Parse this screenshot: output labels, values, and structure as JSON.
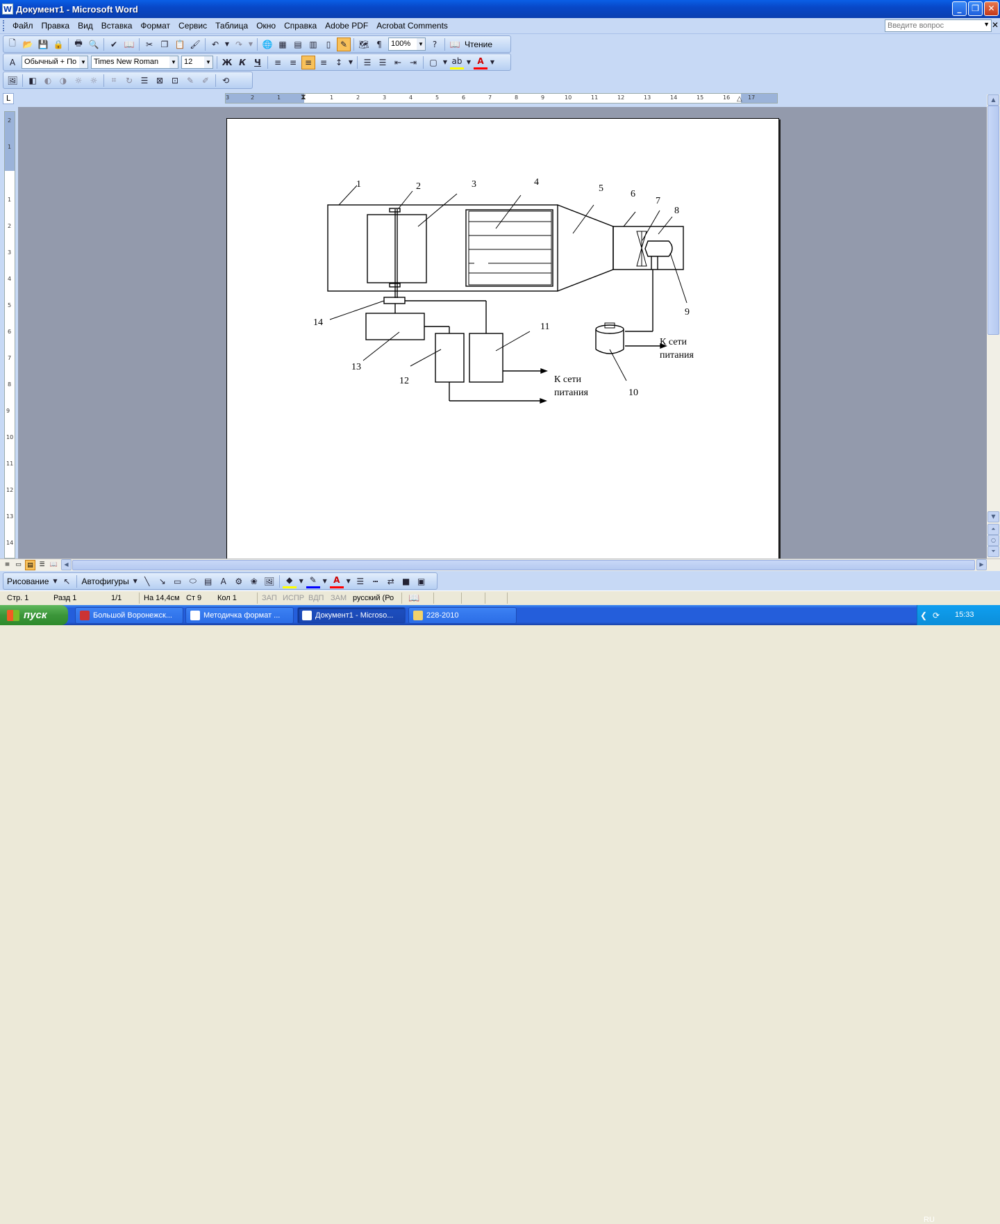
{
  "window": {
    "title": "Документ1 - Microsoft Word",
    "minimize": "_",
    "restore": "❐",
    "close": "✕"
  },
  "menu": {
    "items": [
      "Файл",
      "Правка",
      "Вид",
      "Вставка",
      "Формат",
      "Сервис",
      "Таблица",
      "Окно",
      "Справка",
      "Adobe PDF",
      "Acrobat Comments"
    ],
    "help_placeholder": "Введите вопрос"
  },
  "toolbar": {
    "zoom": "100%",
    "reading_label": "Чтение",
    "style": "Обычный + По г",
    "font": "Times New Roman",
    "size": "12",
    "bold": "Ж",
    "italic": "К",
    "underline": "Ч"
  },
  "ruler": {
    "h_labels": [
      "3",
      "2",
      "1",
      "1",
      "2",
      "3",
      "4",
      "5",
      "6",
      "7",
      "8",
      "9",
      "10",
      "11",
      "12",
      "13",
      "14",
      "15",
      "16",
      "17"
    ],
    "v_labels": [
      "2",
      "1",
      "1",
      "2",
      "3",
      "4",
      "5",
      "6",
      "7",
      "8",
      "9",
      "10",
      "11",
      "12",
      "13",
      "14"
    ]
  },
  "diagram": {
    "labels": [
      "1",
      "2",
      "3",
      "4",
      "5",
      "6",
      "7",
      "8",
      "9",
      "10",
      "11",
      "12",
      "13",
      "14"
    ],
    "power_label_1a": "К сети",
    "power_label_1b": "питания",
    "power_label_2a": "К сети",
    "power_label_2b": "питания"
  },
  "drawing_toolbar": {
    "draw": "Рисование",
    "autoshapes": "Автофигуры"
  },
  "status": {
    "page": "Стр. 1",
    "section": "Разд 1",
    "pages": "1/1",
    "at": "На 14,4см",
    "line": "Ст 9",
    "col": "Кол 1",
    "rec": "ЗАП",
    "trk": "ИСПР",
    "ext": "ВДП",
    "ovr": "ЗАМ",
    "lang": "русский (Ро"
  },
  "taskbar": {
    "start": "пуск",
    "tasks": [
      "Большой Воронежск...",
      "Методичка формат ...",
      "Документ1 - Microso...",
      "228-2010"
    ],
    "lang": "RU",
    "time": "15:33"
  }
}
